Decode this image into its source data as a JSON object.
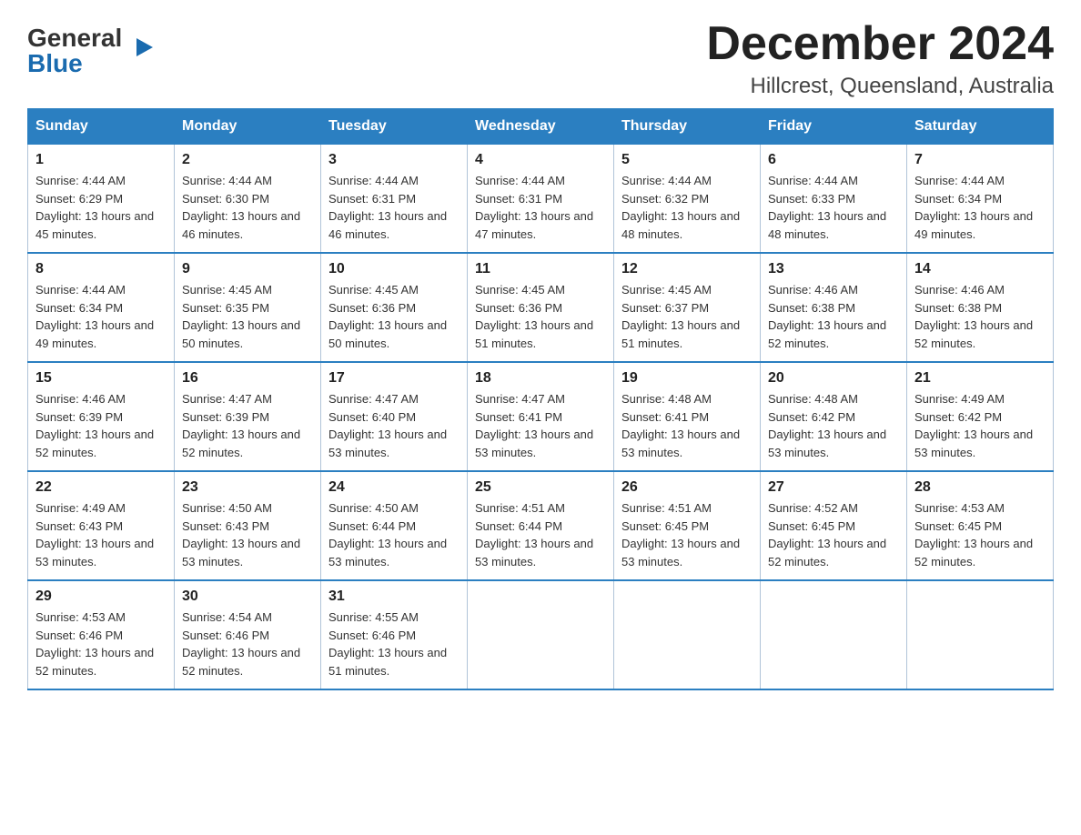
{
  "logo": {
    "general": "General",
    "triangle": "▶",
    "blue": "Blue"
  },
  "title": "December 2024",
  "subtitle": "Hillcrest, Queensland, Australia",
  "days_of_week": [
    "Sunday",
    "Monday",
    "Tuesday",
    "Wednesday",
    "Thursday",
    "Friday",
    "Saturday"
  ],
  "weeks": [
    [
      {
        "num": "1",
        "sunrise": "4:44 AM",
        "sunset": "6:29 PM",
        "daylight": "13 hours and 45 minutes."
      },
      {
        "num": "2",
        "sunrise": "4:44 AM",
        "sunset": "6:30 PM",
        "daylight": "13 hours and 46 minutes."
      },
      {
        "num": "3",
        "sunrise": "4:44 AM",
        "sunset": "6:31 PM",
        "daylight": "13 hours and 46 minutes."
      },
      {
        "num": "4",
        "sunrise": "4:44 AM",
        "sunset": "6:31 PM",
        "daylight": "13 hours and 47 minutes."
      },
      {
        "num": "5",
        "sunrise": "4:44 AM",
        "sunset": "6:32 PM",
        "daylight": "13 hours and 48 minutes."
      },
      {
        "num": "6",
        "sunrise": "4:44 AM",
        "sunset": "6:33 PM",
        "daylight": "13 hours and 48 minutes."
      },
      {
        "num": "7",
        "sunrise": "4:44 AM",
        "sunset": "6:34 PM",
        "daylight": "13 hours and 49 minutes."
      }
    ],
    [
      {
        "num": "8",
        "sunrise": "4:44 AM",
        "sunset": "6:34 PM",
        "daylight": "13 hours and 49 minutes."
      },
      {
        "num": "9",
        "sunrise": "4:45 AM",
        "sunset": "6:35 PM",
        "daylight": "13 hours and 50 minutes."
      },
      {
        "num": "10",
        "sunrise": "4:45 AM",
        "sunset": "6:36 PM",
        "daylight": "13 hours and 50 minutes."
      },
      {
        "num": "11",
        "sunrise": "4:45 AM",
        "sunset": "6:36 PM",
        "daylight": "13 hours and 51 minutes."
      },
      {
        "num": "12",
        "sunrise": "4:45 AM",
        "sunset": "6:37 PM",
        "daylight": "13 hours and 51 minutes."
      },
      {
        "num": "13",
        "sunrise": "4:46 AM",
        "sunset": "6:38 PM",
        "daylight": "13 hours and 52 minutes."
      },
      {
        "num": "14",
        "sunrise": "4:46 AM",
        "sunset": "6:38 PM",
        "daylight": "13 hours and 52 minutes."
      }
    ],
    [
      {
        "num": "15",
        "sunrise": "4:46 AM",
        "sunset": "6:39 PM",
        "daylight": "13 hours and 52 minutes."
      },
      {
        "num": "16",
        "sunrise": "4:47 AM",
        "sunset": "6:39 PM",
        "daylight": "13 hours and 52 minutes."
      },
      {
        "num": "17",
        "sunrise": "4:47 AM",
        "sunset": "6:40 PM",
        "daylight": "13 hours and 53 minutes."
      },
      {
        "num": "18",
        "sunrise": "4:47 AM",
        "sunset": "6:41 PM",
        "daylight": "13 hours and 53 minutes."
      },
      {
        "num": "19",
        "sunrise": "4:48 AM",
        "sunset": "6:41 PM",
        "daylight": "13 hours and 53 minutes."
      },
      {
        "num": "20",
        "sunrise": "4:48 AM",
        "sunset": "6:42 PM",
        "daylight": "13 hours and 53 minutes."
      },
      {
        "num": "21",
        "sunrise": "4:49 AM",
        "sunset": "6:42 PM",
        "daylight": "13 hours and 53 minutes."
      }
    ],
    [
      {
        "num": "22",
        "sunrise": "4:49 AM",
        "sunset": "6:43 PM",
        "daylight": "13 hours and 53 minutes."
      },
      {
        "num": "23",
        "sunrise": "4:50 AM",
        "sunset": "6:43 PM",
        "daylight": "13 hours and 53 minutes."
      },
      {
        "num": "24",
        "sunrise": "4:50 AM",
        "sunset": "6:44 PM",
        "daylight": "13 hours and 53 minutes."
      },
      {
        "num": "25",
        "sunrise": "4:51 AM",
        "sunset": "6:44 PM",
        "daylight": "13 hours and 53 minutes."
      },
      {
        "num": "26",
        "sunrise": "4:51 AM",
        "sunset": "6:45 PM",
        "daylight": "13 hours and 53 minutes."
      },
      {
        "num": "27",
        "sunrise": "4:52 AM",
        "sunset": "6:45 PM",
        "daylight": "13 hours and 52 minutes."
      },
      {
        "num": "28",
        "sunrise": "4:53 AM",
        "sunset": "6:45 PM",
        "daylight": "13 hours and 52 minutes."
      }
    ],
    [
      {
        "num": "29",
        "sunrise": "4:53 AM",
        "sunset": "6:46 PM",
        "daylight": "13 hours and 52 minutes."
      },
      {
        "num": "30",
        "sunrise": "4:54 AM",
        "sunset": "6:46 PM",
        "daylight": "13 hours and 52 minutes."
      },
      {
        "num": "31",
        "sunrise": "4:55 AM",
        "sunset": "6:46 PM",
        "daylight": "13 hours and 51 minutes."
      },
      null,
      null,
      null,
      null
    ]
  ]
}
